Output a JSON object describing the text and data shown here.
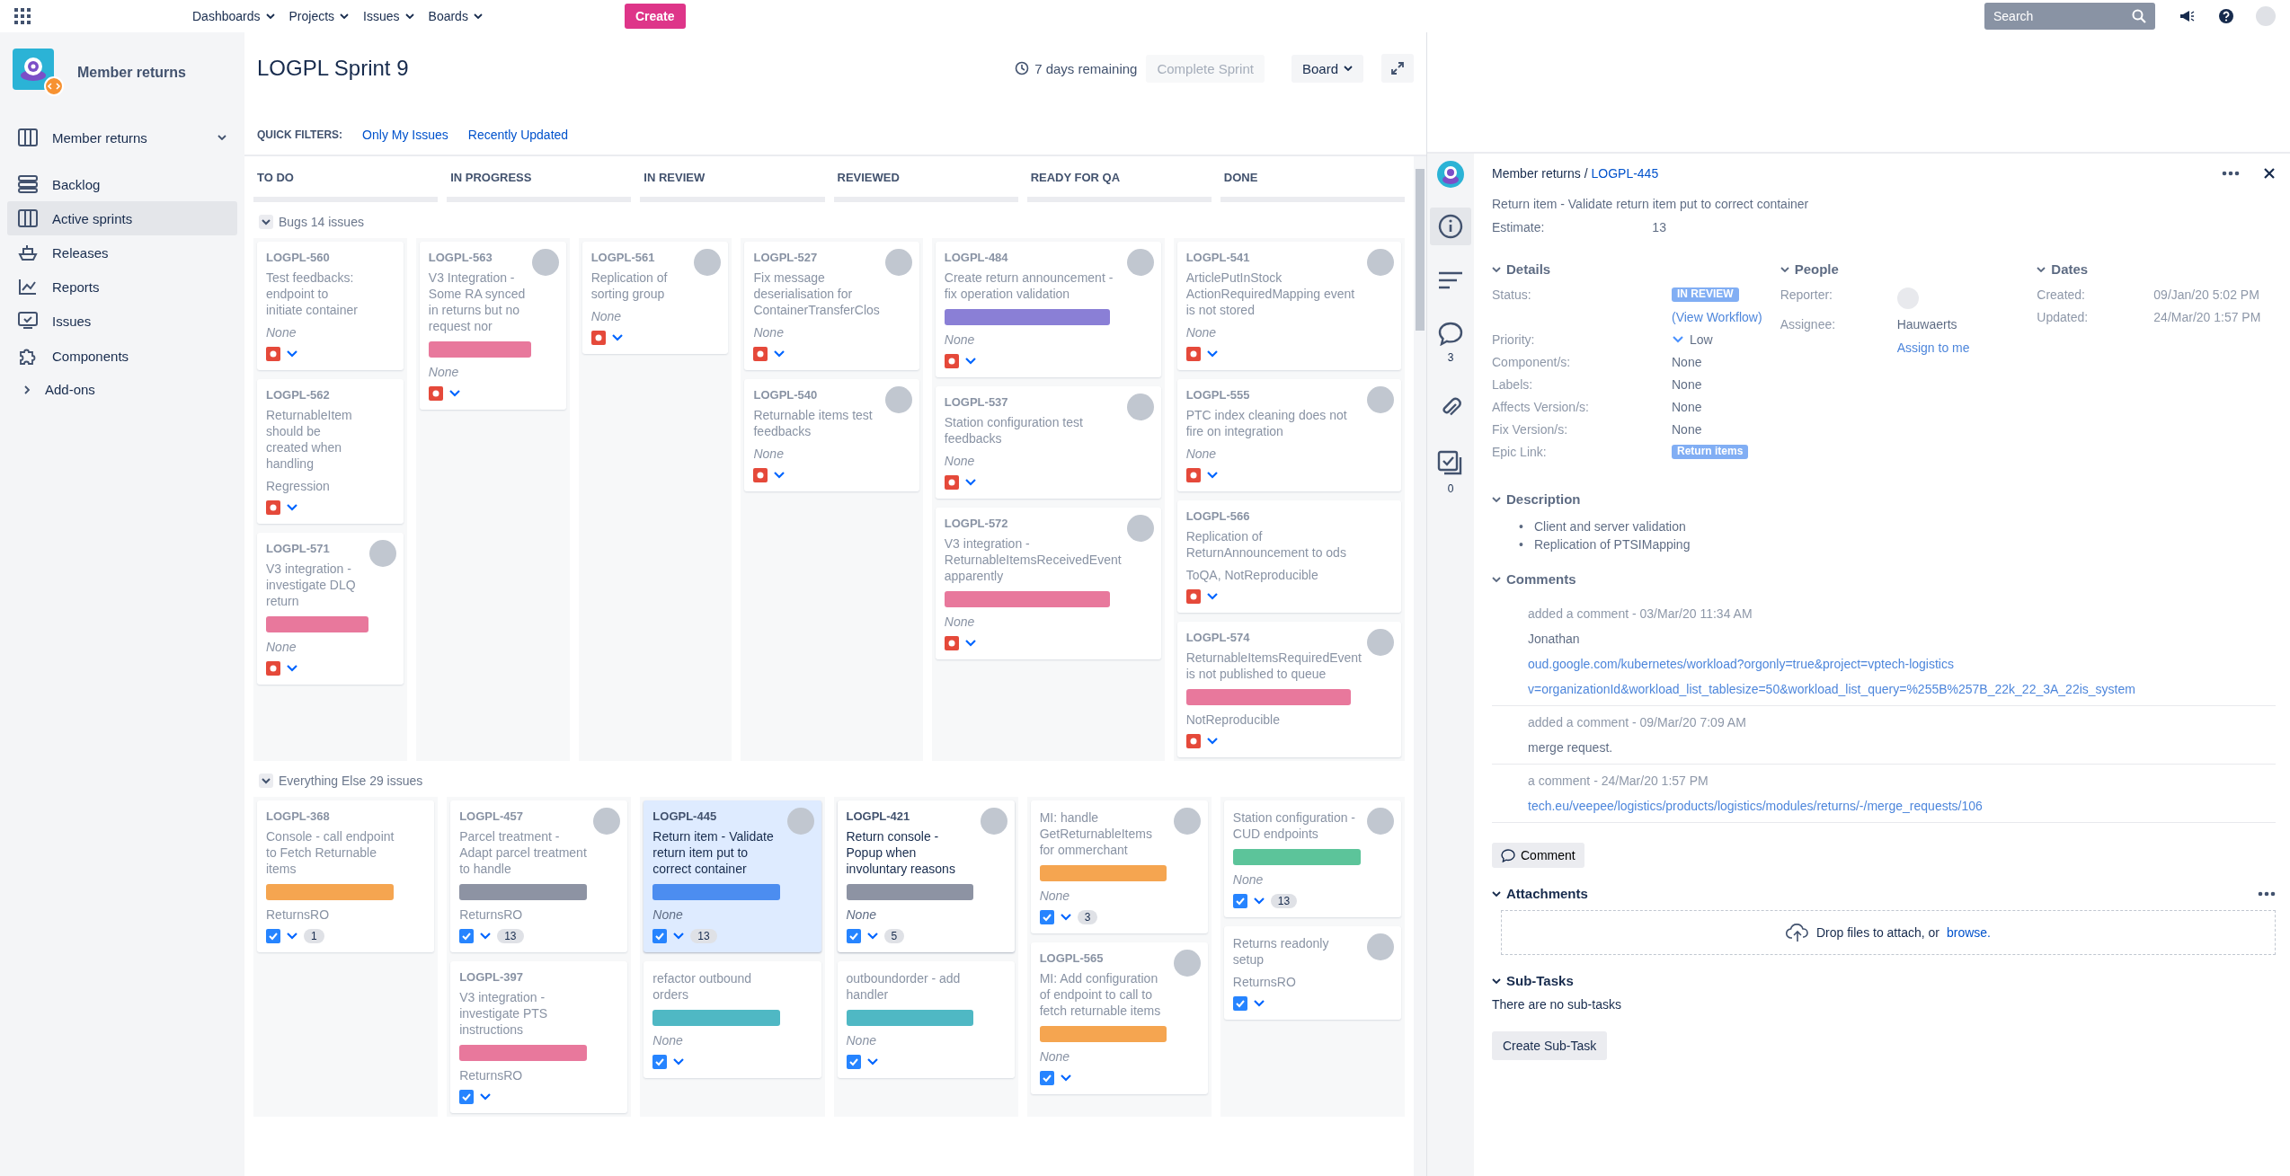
{
  "top_nav": {
    "menus": [
      "Dashboards",
      "Projects",
      "Issues",
      "Boards"
    ],
    "create_button": "Create",
    "search": {
      "placeholder": "Search"
    }
  },
  "sidebar": {
    "project_name": "Member returns",
    "board_selector": "Member returns",
    "items": [
      {
        "label": "Backlog",
        "selected": false
      },
      {
        "label": "Active sprints",
        "selected": true
      },
      {
        "label": "Releases",
        "selected": false
      },
      {
        "label": "Reports",
        "selected": false
      },
      {
        "label": "Issues",
        "selected": false
      },
      {
        "label": "Components",
        "selected": false
      }
    ],
    "addons": "Add-ons"
  },
  "board": {
    "title": "LOGPL Sprint 9",
    "remaining": "7 days remaining",
    "complete_button": "Complete Sprint",
    "board_button": "Board",
    "quick_filters_label": "QUICK FILTERS:",
    "quick_filters": [
      {
        "label": "Only My Issues",
        "selected": false
      },
      {
        "label": "Recently Updated",
        "selected": false
      }
    ],
    "columns": [
      "TO DO",
      "IN PROGRESS",
      "IN REVIEW",
      "REVIEWED",
      "READY FOR QA",
      "DONE"
    ],
    "swimlanes": [
      {
        "title": "Bugs 14 issues",
        "columns": [
          [
            {
              "key": "LOGPL-560",
              "title": "Test feedbacks: endpoint to initiate container",
              "footer": "None",
              "kind": "bug",
              "avatar": false,
              "selected": false,
              "dimmed": true
            },
            {
              "key": "LOGPL-562",
              "title": "ReturnableItem should be created when handling",
              "footer": "Regression",
              "kind": "bug",
              "avatar": false,
              "selected": false,
              "dimmed": true
            },
            {
              "key": "LOGPL-571",
              "title": "V3 integration - investigate DLQ return",
              "color": "#e8789c",
              "footer": "None",
              "kind": "bug",
              "avatar": true,
              "selected": false,
              "dimmed": true
            }
          ],
          [
            {
              "key": "LOGPL-563",
              "title": "V3 Integration - Some RA synced in returns but no request nor",
              "color": "#e8789c",
              "footer": "None",
              "kind": "bug",
              "avatar": true,
              "selected": false,
              "dimmed": true
            }
          ],
          [
            {
              "key": "LOGPL-561",
              "title": "Replication of sorting group",
              "footer": "None",
              "kind": "bug",
              "avatar": true,
              "selected": false,
              "dimmed": true
            }
          ],
          [
            {
              "key": "LOGPL-527",
              "title": "Fix message deserialisation for ContainerTransferClos",
              "footer": "None",
              "kind": "bug",
              "avatar": true,
              "selected": false,
              "dimmed": true
            },
            {
              "key": "LOGPL-540",
              "title": "Returnable items test feedbacks",
              "footer": "None",
              "kind": "bug",
              "avatar": true,
              "selected": false,
              "dimmed": true
            }
          ],
          [
            {
              "key": "LOGPL-484",
              "title": "Create return announcement - fix operation validation",
              "color": "#8a7fd6",
              "footer": "None",
              "kind": "bug",
              "avatar": true,
              "selected": false,
              "dimmed": true
            },
            {
              "key": "LOGPL-537",
              "title": "Station configuration test feedbacks",
              "footer": "None",
              "kind": "bug",
              "avatar": true,
              "selected": false,
              "dimmed": true
            },
            {
              "key": "LOGPL-572",
              "title": "V3 integration - ReturnableItemsReceivedEvent apparently",
              "color": "#e8789c",
              "footer": "None",
              "kind": "bug",
              "avatar": true,
              "selected": false,
              "dimmed": true
            }
          ],
          [
            {
              "key": "LOGPL-541",
              "title": "ArticlePutInStock ActionRequiredMapping event is not stored",
              "footer": "None",
              "kind": "bug",
              "avatar": true,
              "selected": false,
              "dimmed": true
            },
            {
              "key": "LOGPL-555",
              "title": "PTC index cleaning does not fire on integration",
              "footer": "None",
              "kind": "bug",
              "avatar": true,
              "selected": false,
              "dimmed": true
            },
            {
              "key": "LOGPL-566",
              "title": "Replication of ReturnAnnouncement to ods",
              "footer": "ToQA, NotReproducible",
              "kind": "bug",
              "avatar": false,
              "selected": false,
              "dimmed": true
            },
            {
              "key": "LOGPL-574",
              "title": "ReturnableItemsRequiredEvent is not published to queue",
              "color": "#e8789c",
              "footer": "NotReproducible",
              "kind": "bug",
              "avatar": true,
              "selected": false,
              "dimmed": true
            }
          ]
        ]
      },
      {
        "title": "Everything Else 29 issues",
        "columns": [
          [
            {
              "key": "LOGPL-368",
              "title": "Console - call endpoint to Fetch Returnable items",
              "color": "#f5a550",
              "footer": "ReturnsRO",
              "kind": "story",
              "estimate": "1",
              "avatar": false,
              "selected": false,
              "dimmed": true
            }
          ],
          [
            {
              "key": "LOGPL-457",
              "title": "Parcel treatment - Adapt parcel treatment to handle",
              "color": "#8d93a3",
              "footer": "ReturnsRO",
              "kind": "story",
              "estimate": "13",
              "avatar": true,
              "selected": false,
              "dimmed": true
            },
            {
              "key": "LOGPL-397",
              "title": "V3 integration - investigate PTS instructions",
              "color": "#e8789c",
              "footer": "ReturnsRO",
              "kind": "story",
              "avatar": false,
              "selected": false,
              "dimmed": true
            }
          ],
          [
            {
              "key": "LOGPL-445",
              "title": "Return item - Validate return item put to correct container",
              "color": "#4c8df0",
              "footer": "None",
              "kind": "story",
              "estimate": "13",
              "avatar": true,
              "selected": true,
              "dimmed": false
            },
            {
              "title": "refactor outbound orders",
              "color": "#4fb8c4",
              "footer": "None",
              "kind": "story",
              "avatar": false,
              "selected": false,
              "dimmed": true
            }
          ],
          [
            {
              "key": "LOGPL-421",
              "title": "Return console - Popup when involuntary reasons",
              "color": "#8d93a3",
              "footer": "None",
              "kind": "story",
              "estimate": "5",
              "avatar": true,
              "selected": false,
              "dimmed": false
            },
            {
              "title": "outboundorder - add handler",
              "color": "#4fb8c4",
              "footer": "None",
              "kind": "story",
              "avatar": false,
              "selected": false,
              "dimmed": true
            }
          ],
          [
            {
              "title": "MI: handle GetReturnableItems for ommerchant",
              "color": "#f5a550",
              "footer": "None",
              "kind": "story",
              "estimate": "3",
              "avatar": true,
              "selected": false,
              "dimmed": true
            },
            {
              "key": "LOGPL-565",
              "title": "MI: Add configuration of endpoint to call to fetch returnable items",
              "color": "#f5a550",
              "footer": "None",
              "kind": "story",
              "avatar": true,
              "selected": false,
              "dimmed": true
            }
          ],
          [
            {
              "title": "Station configuration - CUD endpoints",
              "color": "#5cc49a",
              "footer": "None",
              "kind": "story",
              "estimate": "13",
              "avatar": true,
              "selected": false,
              "dimmed": true
            },
            {
              "title": "Returns readonly setup",
              "footer": "ReturnsRO",
              "kind": "story",
              "avatar": true,
              "selected": false,
              "dimmed": true
            }
          ]
        ]
      }
    ]
  },
  "detail": {
    "project": "Member returns",
    "separator": "/",
    "issue_key": "LOGPL-445",
    "rail": [
      {
        "selected": true
      },
      {
        "selected": false
      },
      {
        "count": "3",
        "selected": false
      },
      {
        "selected": false
      },
      {
        "count": "0",
        "selected": false
      }
    ],
    "summary": "Return item - Validate return item put to correct container",
    "estimate_label": "Estimate:",
    "estimate": "13",
    "details": {
      "title": "Details",
      "fields": [
        {
          "label": "Status:",
          "value": "IN REVIEW",
          "kind": "status"
        },
        {
          "value": "(View Workflow)",
          "kind": "link"
        },
        {
          "label": "Priority:",
          "value": "Low",
          "kind": "priority"
        },
        {
          "label": "Component/s:",
          "value": "None",
          "kind": "text"
        },
        {
          "label": "Labels:",
          "value": "None",
          "kind": "text"
        },
        {
          "label": "Affects Version/s:",
          "value": "None",
          "kind": "text"
        },
        {
          "label": "Fix Version/s:",
          "value": "None",
          "kind": "text"
        },
        {
          "label": "Epic Link:",
          "value": "Return items",
          "kind": "epic"
        }
      ]
    },
    "people": {
      "title": "People",
      "reporter_label": "Reporter:",
      "assignee_label": "Assignee:",
      "assignee": "Hauwaerts",
      "assign_link": "Assign to me"
    },
    "dates": {
      "title": "Dates",
      "rows": [
        {
          "label": "Created:",
          "value": "09/Jan/20 5:02 PM"
        },
        {
          "label": "Updated:",
          "value": "24/Mar/20 1:57 PM"
        }
      ]
    },
    "description": {
      "title": "Description",
      "marker": "•",
      "bullets": [
        "Client and server validation",
        "Replication of PTSIMapping"
      ]
    },
    "comments": {
      "title": "Comments",
      "items": [
        {
          "header": "added a comment - 03/Mar/20 11:34 AM",
          "lines": [
            "Jonathan",
            "oud.google.com/kubernetes/workload?orgonly=true&project=vptech-logistics",
            "v=organizationId&workload_list_tablesize=50&workload_list_query=%255B%257B_22k_22_3A_22is_system"
          ]
        },
        {
          "header": "added a comment - 09/Mar/20 7:09 AM",
          "lines": [
            "merge request."
          ]
        },
        {
          "header": "a comment - 24/Mar/20 1:57 PM",
          "lines": [
            "tech.eu/veepee/logistics/products/logistics/modules/returns/-/merge_requests/106"
          ]
        }
      ]
    },
    "comment_button": "Comment",
    "attachments": {
      "title": "Attachments",
      "drop_text": "Drop files to attach, or",
      "browse_link": "browse."
    },
    "subtasks": {
      "title": "Sub-Tasks",
      "empty": "There are no sub-tasks",
      "create_button": "Create Sub-Task"
    }
  }
}
